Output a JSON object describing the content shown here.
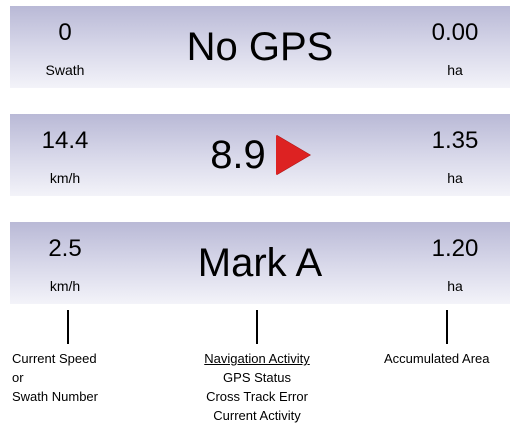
{
  "panels": [
    {
      "left_value": "0",
      "left_unit": "Swath",
      "center_text": "No GPS",
      "right_value": "0.00",
      "right_unit": "ha"
    },
    {
      "left_value": "14.4",
      "left_unit": "km/h",
      "center_text": "8.9",
      "center_icon": "red-right-arrow-icon",
      "right_value": "1.35",
      "right_unit": "ha"
    },
    {
      "left_value": "2.5",
      "left_unit": "km/h",
      "center_text": "Mark A",
      "right_value": "1.20",
      "right_unit": "ha"
    }
  ],
  "legend": {
    "left": [
      "Current Speed",
      "or",
      "Swath Number"
    ],
    "center": [
      "Navigation Activity",
      "GPS Status",
      "Cross Track Error",
      "Current Activity"
    ],
    "right": [
      "Accumulated Area"
    ]
  },
  "colors": {
    "panel_top": "#b9b9d6",
    "panel_bottom": "#f3f3f9",
    "arrow": "#dd2222"
  }
}
